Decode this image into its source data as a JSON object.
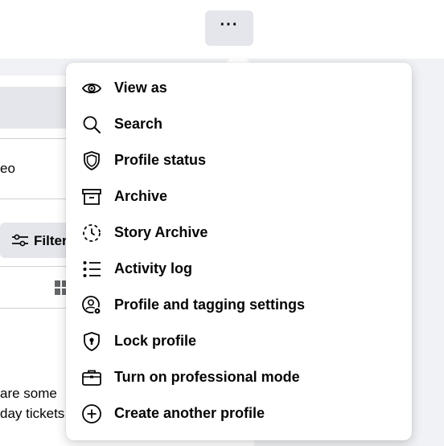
{
  "header": {
    "more_label": "···"
  },
  "background": {
    "video_fragment": "eo",
    "filter_label": "Filter",
    "post_line_1": "are some",
    "post_line_2": "day tickets"
  },
  "menu": {
    "items": [
      {
        "label": "View as",
        "icon": "eye-icon"
      },
      {
        "label": "Search",
        "icon": "search-icon"
      },
      {
        "label": "Profile status",
        "icon": "shield-icon"
      },
      {
        "label": "Archive",
        "icon": "archive-box-icon"
      },
      {
        "label": "Story Archive",
        "icon": "story-archive-icon"
      },
      {
        "label": "Activity log",
        "icon": "list-icon"
      },
      {
        "label": "Profile and tagging settings",
        "icon": "profile-settings-icon"
      },
      {
        "label": "Lock profile",
        "icon": "lock-shield-icon"
      },
      {
        "label": "Turn on professional mode",
        "icon": "briefcase-icon"
      },
      {
        "label": "Create another profile",
        "icon": "plus-circle-icon"
      }
    ]
  }
}
